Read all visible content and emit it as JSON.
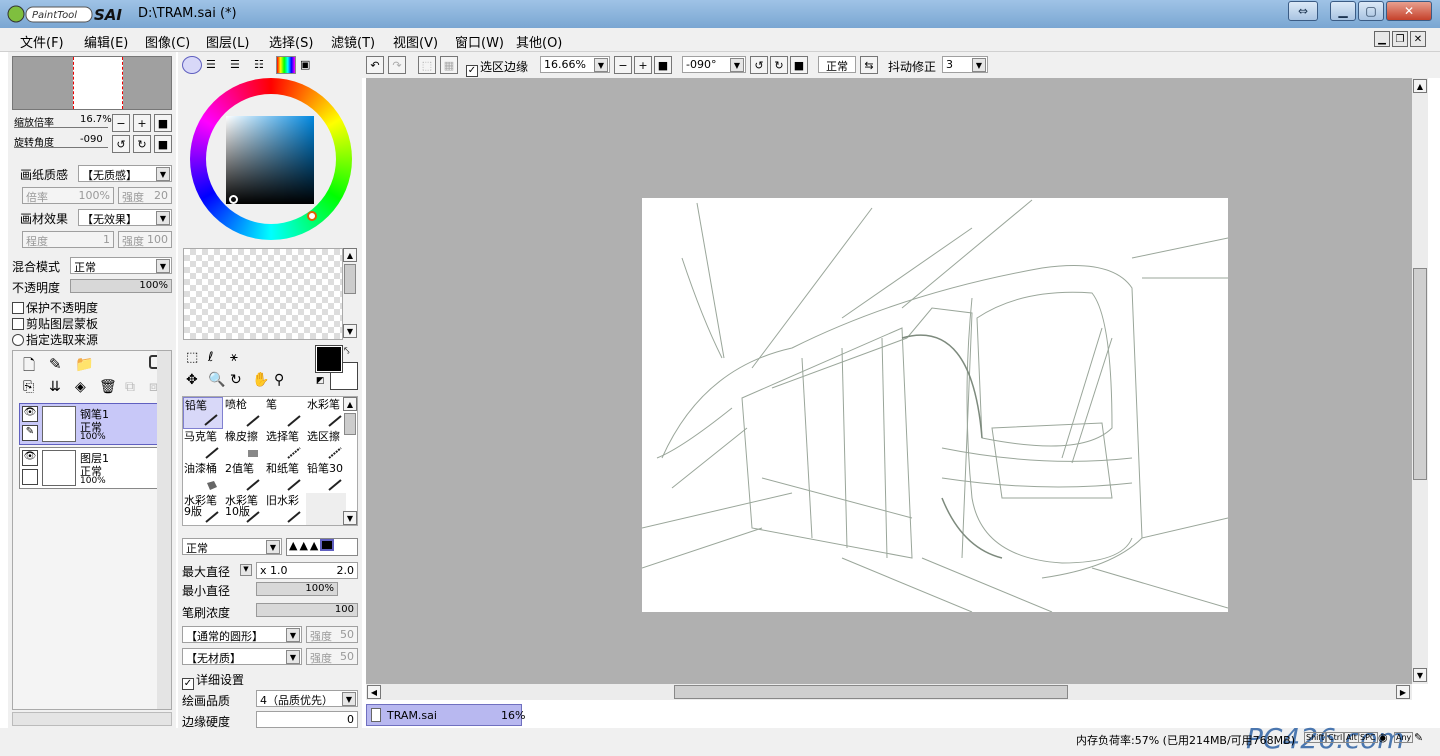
{
  "window": {
    "app_logo": "PaintTool SAI",
    "title": "D:\\TRAM.sai (*)"
  },
  "menu": [
    "文件(F)",
    "编辑(E)",
    "图像(C)",
    "图层(L)",
    "选择(S)",
    "滤镜(T)",
    "视图(V)",
    "窗口(W)",
    "其他(O)"
  ],
  "navigator": {
    "zoom_label": "缩放倍率",
    "zoom_value": "16.7%",
    "rotate_label": "旋转角度",
    "rotate_value": "-090"
  },
  "paper": {
    "texture_label": "画纸质感",
    "texture_value": "【无质感】",
    "scale_label": "倍率",
    "scale_value": "100%",
    "strength_label": "强度",
    "strength_value": "20",
    "effect_label": "画材效果",
    "effect_value": "【无效果】",
    "degree_label": "程度",
    "degree_value": "1",
    "effect_strength_label": "强度",
    "effect_strength_value": "100"
  },
  "blend": {
    "mode_label": "混合模式",
    "mode_value": "正常",
    "opacity_label": "不透明度",
    "opacity_value": "100%",
    "opacity_fraction": 1.0,
    "protect_label": "保护不透明度",
    "clip_label": "剪贴图层蒙板",
    "source_label": "指定选取来源"
  },
  "layers": [
    {
      "name": "钢笔1",
      "mode": "正常",
      "opacity": "100%",
      "selected": true
    },
    {
      "name": "图层1",
      "mode": "正常",
      "opacity": "100%",
      "selected": false
    }
  ],
  "tools": [
    {
      "label": "铅笔",
      "selected": true
    },
    {
      "label": "喷枪"
    },
    {
      "label": "笔"
    },
    {
      "label": "水彩笔"
    },
    {
      "label": "马克笔"
    },
    {
      "label": "橡皮擦"
    },
    {
      "label": "选择笔"
    },
    {
      "label": "选区擦"
    },
    {
      "label": "油漆桶"
    },
    {
      "label": "2值笔"
    },
    {
      "label": "和纸笔"
    },
    {
      "label": "铅笔30"
    },
    {
      "label": "水彩笔9版"
    },
    {
      "label": "水彩笔10版"
    },
    {
      "label": "旧水彩"
    }
  ],
  "brush": {
    "mode_value": "正常",
    "max_size_label": "最大直径",
    "max_size_mult": "x 1.0",
    "max_size_value": "2.0",
    "min_size_label": "最小直径",
    "min_size_value": "100%",
    "density_label": "笔刷浓度",
    "density_value": "100",
    "shape_value": "【通常的圆形】",
    "shape_strength_label": "强度",
    "shape_strength_value": "50",
    "texture_value": "【无材质】",
    "texture_strength_label": "强度",
    "texture_strength_value": "50",
    "detail_label": "详细设置",
    "quality_label": "绘画品质",
    "quality_value": "4（品质优先）",
    "edge_label": "边缘硬度",
    "edge_value": "0"
  },
  "toolbar": {
    "selection_edge_label": "选区边缘",
    "zoom_value": "16.66%",
    "angle_value": "-090°",
    "mode_value": "正常",
    "stabilizer_label": "抖动修正",
    "stabilizer_value": "3"
  },
  "doc_tab": {
    "name": "TRAM.sai",
    "zoom": "16%"
  },
  "status": {
    "memory": "内存负荷率:57% (已用214MB/可用768MB)",
    "keys": [
      "Shift",
      "Ctrl",
      "Alt",
      "SPC",
      "Any"
    ],
    "watermark": "PC426.com"
  },
  "colors": {
    "accent": "#c8c8f8",
    "canvas_bg": "#b0b0b0",
    "title_grad": "#7aa6d2"
  }
}
